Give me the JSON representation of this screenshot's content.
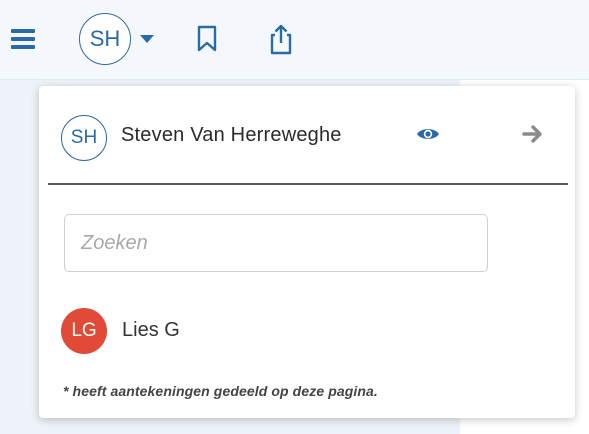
{
  "toolbar": {
    "avatar_initials": "SH",
    "icons": [
      "menu-icon",
      "chevron-down-icon",
      "bookmark-icon",
      "share-icon"
    ]
  },
  "dropdown": {
    "current_user": {
      "initials": "SH",
      "name": "Steven Van Herreweghe",
      "icons": [
        "eye-icon",
        "arrow-right-icon"
      ]
    },
    "search": {
      "placeholder": "Zoeken",
      "value": ""
    },
    "users": [
      {
        "initials": "LG",
        "name": "Lies G",
        "avatar_color": "#e04a36"
      }
    ],
    "footnote": "* heeft aantekeningen gedeeld op deze pagina."
  },
  "colors": {
    "accent": "#2a6aa5",
    "toolbar_bg": "#f4f8fc",
    "lg_avatar": "#e04a36"
  }
}
